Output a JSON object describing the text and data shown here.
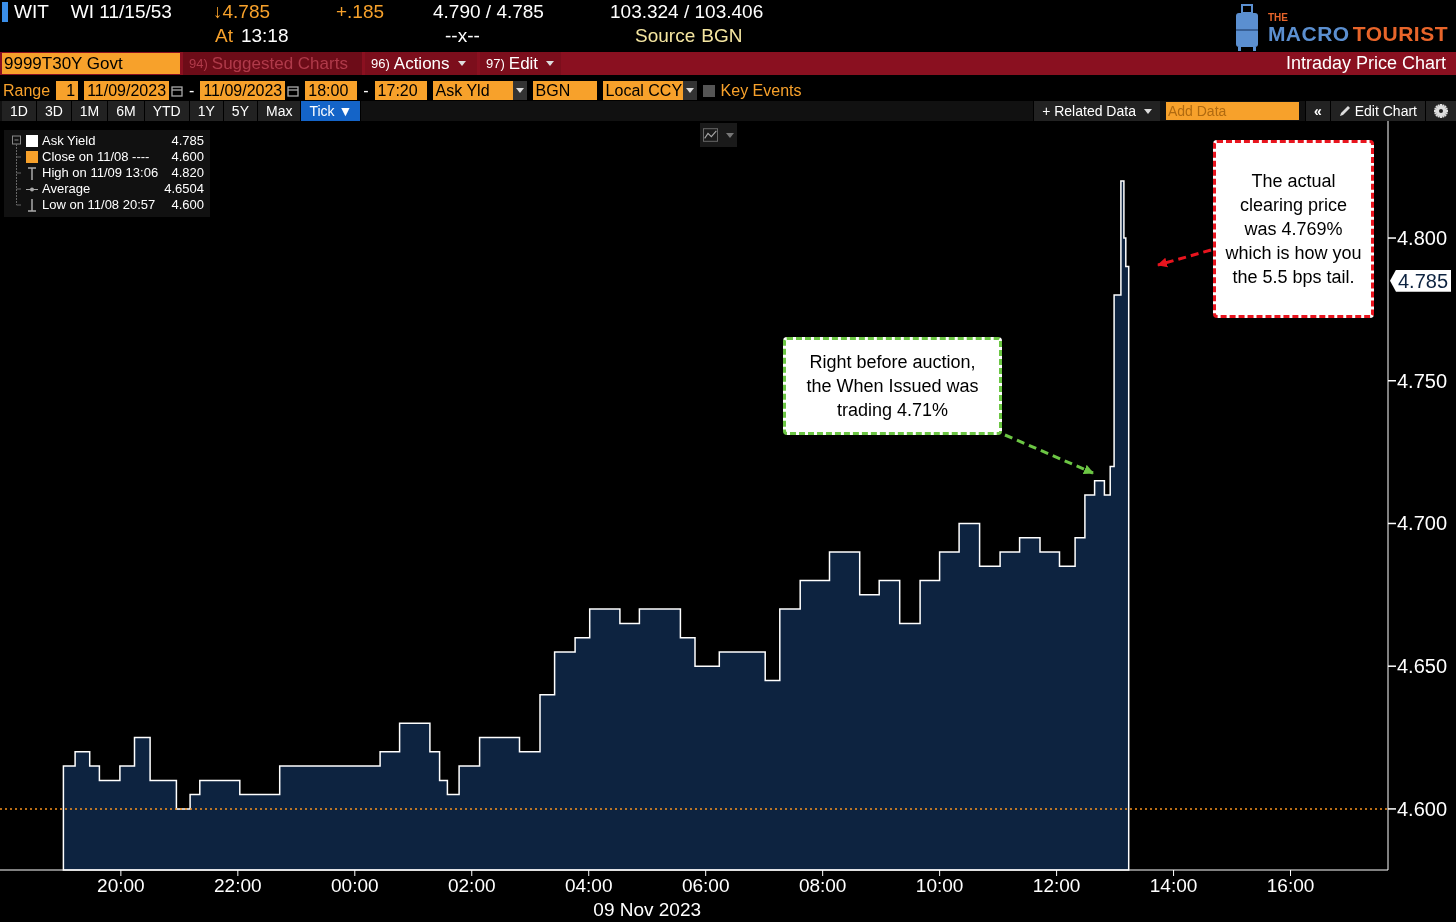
{
  "header": {
    "ticker": "WIT",
    "security": "WI 11/15/53",
    "last": "↓4.785",
    "change": "+.185",
    "bid_ask": "4.790 / 4.785",
    "price_bid_ask": "103.324 / 103.406",
    "time_label": "At",
    "time": "13:18",
    "size": "--x--",
    "source_label": "Source",
    "source": "BGN"
  },
  "logo": {
    "small": "THE",
    "word1": "MACRO",
    "word2": "TOURIST"
  },
  "command_bar": {
    "security_field": "9999T30Y Govt",
    "menus": [
      {
        "number": "94)",
        "label": "Suggested Charts",
        "disabled": true,
        "dropdown": false
      },
      {
        "number": "96)",
        "label": "Actions",
        "disabled": false,
        "dropdown": true
      },
      {
        "number": "97)",
        "label": "Edit",
        "disabled": false,
        "dropdown": true
      }
    ],
    "title": "Intraday Price Chart"
  },
  "range_bar": {
    "label": "Range",
    "items": [
      {
        "kind": "number",
        "value": "1"
      },
      {
        "kind": "date",
        "value": "11/09/2023"
      },
      {
        "kind": "dash",
        "text": "-"
      },
      {
        "kind": "date",
        "value": "11/09/2023"
      },
      {
        "kind": "time",
        "value": "18:00"
      },
      {
        "kind": "dash",
        "text": "-"
      },
      {
        "kind": "time",
        "value": "17:20"
      },
      {
        "kind": "select",
        "value": "Ask Yld"
      },
      {
        "kind": "text",
        "value": "BGN"
      },
      {
        "kind": "select",
        "value": "Local CCY"
      },
      {
        "kind": "checkbox",
        "label": "Key Events",
        "checked": false
      }
    ]
  },
  "period_tabs": [
    {
      "label": "1D",
      "selected": false
    },
    {
      "label": "3D",
      "selected": false
    },
    {
      "label": "1M",
      "selected": false
    },
    {
      "label": "6M",
      "selected": false
    },
    {
      "label": "YTD",
      "selected": false
    },
    {
      "label": "1Y",
      "selected": false
    },
    {
      "label": "5Y",
      "selected": false
    },
    {
      "label": "Max",
      "selected": false
    },
    {
      "label": "Tick ▼",
      "selected": true
    }
  ],
  "chart_toolbar": {
    "related_data": "+ Related Data",
    "add_data_placeholder": "Add Data",
    "collapse": "«",
    "edit_chart": "Edit Chart"
  },
  "legend": [
    {
      "kind": "series",
      "value": "4.785"
    },
    {
      "kind": "swatch",
      "color": "#f7a12b",
      "label": "Close on 11/08 ----",
      "value": "4.600"
    },
    {
      "kind": "high",
      "label": "High on 11/09 13:06",
      "value": "4.820"
    },
    {
      "kind": "average",
      "label": "Average",
      "value": "4.6504"
    },
    {
      "kind": "low",
      "label": "Low on 11/08 20:57",
      "value": "4.600"
    }
  ],
  "chart_data": {
    "type": "area",
    "xlabel": "09 Nov 2023",
    "x": [
      "2023-11-08T19:01",
      "2023-11-08T19:13",
      "2023-11-08T19:28",
      "2023-11-08T19:38",
      "2023-11-08T19:59",
      "2023-11-08T20:14",
      "2023-11-08T20:30",
      "2023-11-08T20:57",
      "2023-11-08T21:11",
      "2023-11-08T21:21",
      "2023-11-08T22:02",
      "2023-11-08T22:43",
      "2023-11-08T23:44",
      "2023-11-09T00:26",
      "2023-11-09T00:46",
      "2023-11-09T01:17",
      "2023-11-09T01:27",
      "2023-11-09T01:35",
      "2023-11-09T01:47",
      "2023-11-09T02:08",
      "2023-11-09T02:49",
      "2023-11-09T03:10",
      "2023-11-09T03:25",
      "2023-11-09T03:46",
      "2023-11-09T04:01",
      "2023-11-09T04:32",
      "2023-11-09T04:52",
      "2023-11-09T05:13",
      "2023-11-09T05:34",
      "2023-11-09T05:49",
      "2023-11-09T06:14",
      "2023-11-09T06:35",
      "2023-11-09T07:01",
      "2023-11-09T07:16",
      "2023-11-09T07:37",
      "2023-11-09T08:07",
      "2023-11-09T08:38",
      "2023-11-09T08:58",
      "2023-11-09T09:19",
      "2023-11-09T09:40",
      "2023-11-09T10:00",
      "2023-11-09T10:20",
      "2023-11-09T10:41",
      "2023-11-09T11:02",
      "2023-11-09T11:22",
      "2023-11-09T11:43",
      "2023-11-09T12:03",
      "2023-11-09T12:19",
      "2023-11-09T12:29",
      "2023-11-09T12:39",
      "2023-11-09T12:49",
      "2023-11-09T12:55",
      "2023-11-09T12:59",
      "2023-11-09T13:06",
      "2023-11-09T13:09",
      "2023-11-09T13:11",
      "2023-11-09T13:14"
    ],
    "series": [
      {
        "name": "Ask Yield",
        "color": "#ffffff",
        "values": [
          4.615,
          4.62,
          4.615,
          4.61,
          4.615,
          4.625,
          4.61,
          4.6,
          4.605,
          4.61,
          4.605,
          4.615,
          4.615,
          4.62,
          4.63,
          4.62,
          4.61,
          4.605,
          4.615,
          4.625,
          4.62,
          4.64,
          4.655,
          4.66,
          4.67,
          4.665,
          4.67,
          4.67,
          4.66,
          4.65,
          4.655,
          4.655,
          4.645,
          4.67,
          4.68,
          4.69,
          4.675,
          4.68,
          4.665,
          4.68,
          4.69,
          4.7,
          4.685,
          4.69,
          4.695,
          4.69,
          4.685,
          4.695,
          4.71,
          4.715,
          4.71,
          4.72,
          4.78,
          4.82,
          4.8,
          4.79,
          4.785
        ]
      }
    ],
    "xlim": [
      "2023-11-08T17:56",
      "2023-11-09T17:40"
    ],
    "ylim": [
      4.5786,
      4.8396
    ],
    "xticks": [
      {
        "value": "2023-11-08T20:00",
        "label": "20:00"
      },
      {
        "value": "2023-11-08T22:00",
        "label": "22:00"
      },
      {
        "value": "2023-11-09T00:00",
        "label": "00:00"
      },
      {
        "value": "2023-11-09T02:00",
        "label": "02:00"
      },
      {
        "value": "2023-11-09T04:00",
        "label": "04:00"
      },
      {
        "value": "2023-11-09T06:00",
        "label": "06:00"
      },
      {
        "value": "2023-11-09T08:00",
        "label": "08:00"
      },
      {
        "value": "2023-11-09T10:00",
        "label": "10:00"
      },
      {
        "value": "2023-11-09T12:00",
        "label": "12:00"
      },
      {
        "value": "2023-11-09T14:00",
        "label": "14:00"
      },
      {
        "value": "2023-11-09T16:00",
        "label": "16:00"
      }
    ],
    "yticks": [
      {
        "value": 4.6,
        "label": "4.600"
      },
      {
        "value": 4.65,
        "label": "4.650"
      },
      {
        "value": 4.7,
        "label": "4.700"
      },
      {
        "value": 4.75,
        "label": "4.750"
      },
      {
        "value": 4.8,
        "label": "4.800"
      }
    ],
    "ref_lines": [
      {
        "axis": "y",
        "value": 4.6,
        "color": "#f7931e"
      }
    ]
  },
  "value_tag": "4.785",
  "callouts": [
    {
      "text": "Right before auction, the When Issued was trading 4.71%",
      "color": "#6cc644"
    },
    {
      "text": "The actual clearing price was 4.769% which is how you the 5.5 bps tail.",
      "color": "#e8141e"
    }
  ]
}
